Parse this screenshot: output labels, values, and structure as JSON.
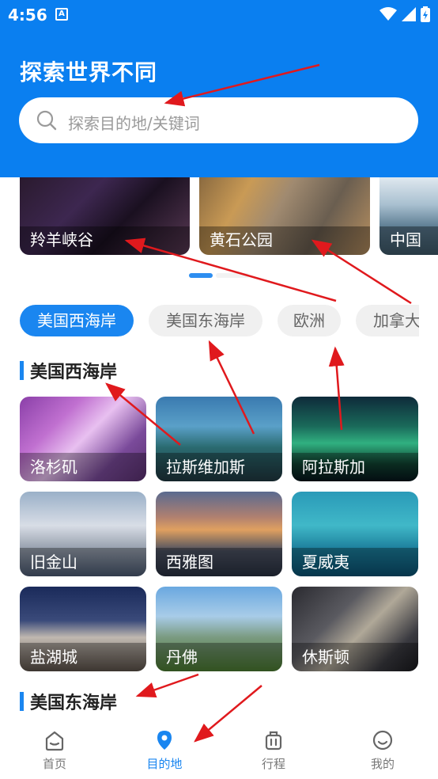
{
  "status_bar": {
    "time": "4:56",
    "notification_letter": "A"
  },
  "header": {
    "title": "探索世界不同",
    "search": {
      "placeholder": "探索目的地/关键词"
    }
  },
  "banners": [
    {
      "label": "羚羊峡谷"
    },
    {
      "label": "黄石公园"
    },
    {
      "label": "中国"
    }
  ],
  "carousel": {
    "current_page": 1
  },
  "region_tabs": [
    {
      "label": "美国西海岸",
      "selected": true
    },
    {
      "label": "美国东海岸",
      "selected": false
    },
    {
      "label": "欧洲",
      "selected": false
    },
    {
      "label": "加拿大",
      "selected": false
    }
  ],
  "sections": [
    {
      "title": "美国西海岸",
      "cities": [
        {
          "name": "洛杉矶"
        },
        {
          "name": "拉斯维加斯"
        },
        {
          "name": "阿拉斯加"
        },
        {
          "name": "旧金山"
        },
        {
          "name": "西雅图"
        },
        {
          "name": "夏威夷"
        },
        {
          "name": "盐湖城"
        },
        {
          "name": "丹佛"
        },
        {
          "name": "休斯顿"
        }
      ]
    },
    {
      "title": "美国东海岸"
    }
  ],
  "bottom_nav": [
    {
      "label": "首页",
      "icon": "home-icon",
      "active": false
    },
    {
      "label": "目的地",
      "icon": "location-pin-icon",
      "active": true
    },
    {
      "label": "行程",
      "icon": "luggage-icon",
      "active": false
    },
    {
      "label": "我的",
      "icon": "smiley-profile-icon",
      "active": false
    }
  ],
  "colors": {
    "primary": "#0a7ff0",
    "accent": "#1a86f0",
    "annotation_arrow": "#e0191d"
  }
}
